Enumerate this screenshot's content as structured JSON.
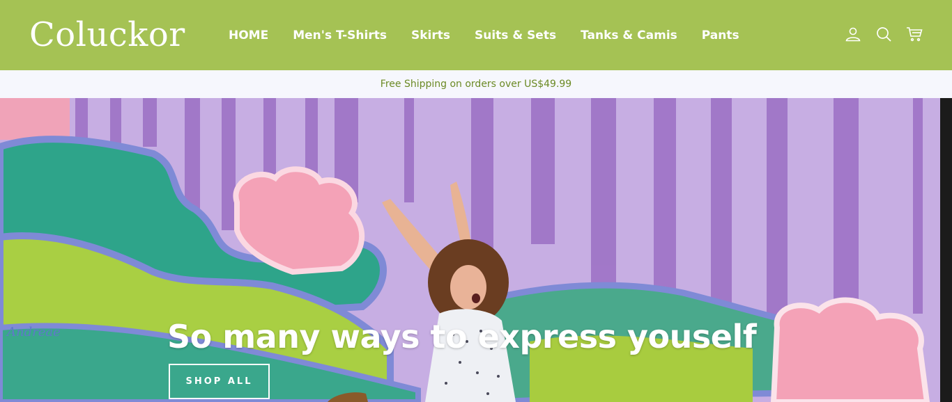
{
  "header": {
    "logo": "Coluckor",
    "nav": [
      {
        "label": "HOME"
      },
      {
        "label": "Men's T-Shirts"
      },
      {
        "label": "Skirts"
      },
      {
        "label": "Suits & Sets"
      },
      {
        "label": "Tanks & Camis"
      },
      {
        "label": "Pants"
      }
    ],
    "icons": [
      "user-icon",
      "search-icon",
      "cart-icon"
    ]
  },
  "announcement": "Free Shipping on orders over US$49.99",
  "hero": {
    "title": "So many ways to express youself",
    "button": "SHOP ALL",
    "mural_signature": "Andreae"
  },
  "colors": {
    "header_bg": "#a5c254",
    "announce_bg": "#f6f7fd",
    "announce_text": "#6b8a24"
  }
}
